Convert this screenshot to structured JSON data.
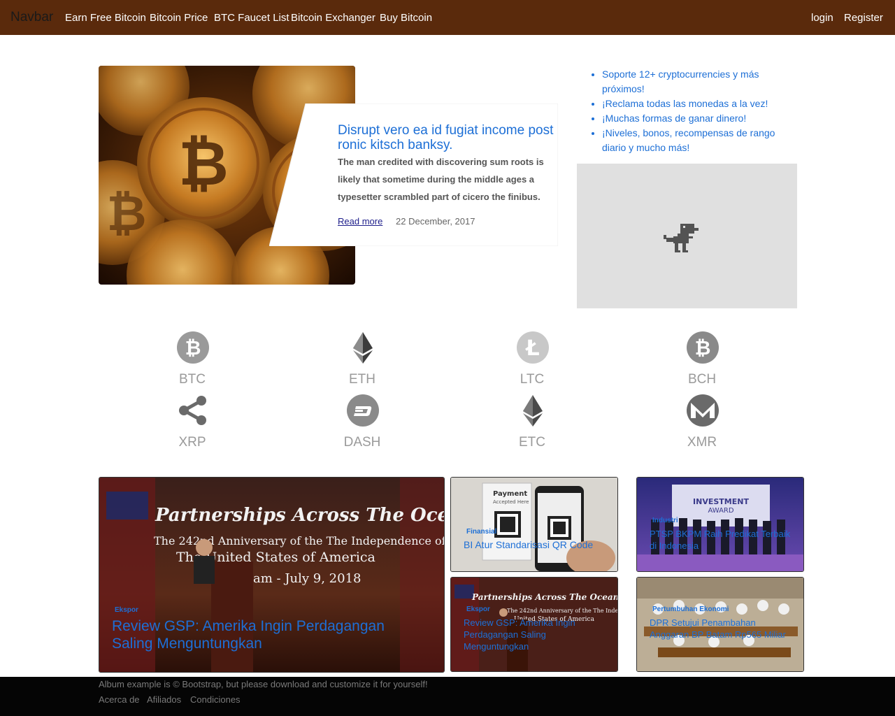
{
  "navbar": {
    "brand": "Navbar",
    "links": [
      "Earn Free Bitcoin",
      "Bitcoin Price",
      "BTC Faucet List",
      "Bitcoin Exchanger",
      "Buy Bitcoin"
    ],
    "login": "login",
    "register": "Register",
    "bg_color": "#5a2a0c"
  },
  "hero": {
    "title": "Disrupt vero ea id fugiat income post ronic kitsch banksy.",
    "text": "The man credited with discovering sum roots is likely that sometime during the middle ages a typesetter scrambled part of cicero the finibus.",
    "read_more": "Read more",
    "date": "22 December, 2017"
  },
  "features": [
    "Soporte 12+ cryptocurrencies y más próximos!",
    "¡Reclama todas las monedas a la vez!",
    "¡Muchas formas de ganar dinero!",
    "¡Niveles, bonos, recompensas de rango diario y mucho más!"
  ],
  "coins": [
    {
      "label": "BTC",
      "icon": "bitcoin-icon"
    },
    {
      "label": "ETH",
      "icon": "ethereum-icon"
    },
    {
      "label": "LTC",
      "icon": "litecoin-icon"
    },
    {
      "label": "BCH",
      "icon": "bitcoin-cash-icon"
    },
    {
      "label": "XRP",
      "icon": "ripple-icon"
    },
    {
      "label": "DASH",
      "icon": "dash-icon"
    },
    {
      "label": "ETC",
      "icon": "ethereum-classic-icon"
    },
    {
      "label": "XMR",
      "icon": "monero-icon"
    }
  ],
  "news": [
    {
      "category": "Ekspor",
      "title": "Review GSP: Amerika Ingin Perdagangan Saling Menguntungkan"
    },
    {
      "category": "Finansial",
      "title": "BI Atur Standarisasi QR Code"
    },
    {
      "category": "Ekspor",
      "title": "Review GSP: Amerika Ingin Perdagangan Saling Menguntungkan"
    },
    {
      "category": "Industri",
      "title": "PTSP BKPM Raih Predikat Terbaik di Indonesia"
    },
    {
      "category": "Pertumbuhan Ekonomi",
      "title": "DPR Setujui Penambahan Anggaran BP Batam Rp565 Miliar"
    }
  ],
  "footer": {
    "text": "Album example is © Bootstrap, but please download and customize it for yourself!",
    "links": [
      "Acerca de",
      "Afiliados",
      "Condiciones"
    ]
  }
}
